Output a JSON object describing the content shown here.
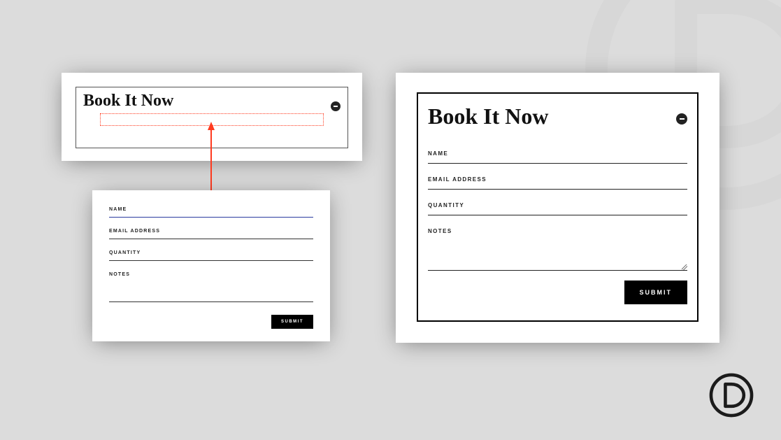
{
  "builder": {
    "title": "Book It Now"
  },
  "small_form": {
    "fields": {
      "name_label": "NAME",
      "email_label": "EMAIL ADDRESS",
      "quantity_label": "QUANTITY",
      "notes_label": "NOTES"
    },
    "submit_label": "SUBMIT"
  },
  "large_form": {
    "title": "Book It Now",
    "fields": {
      "name_label": "NAME",
      "email_label": "EMAIL ADDRESS",
      "quantity_label": "QUANTITY",
      "notes_label": "NOTES"
    },
    "submit_label": "SUBMIT"
  }
}
